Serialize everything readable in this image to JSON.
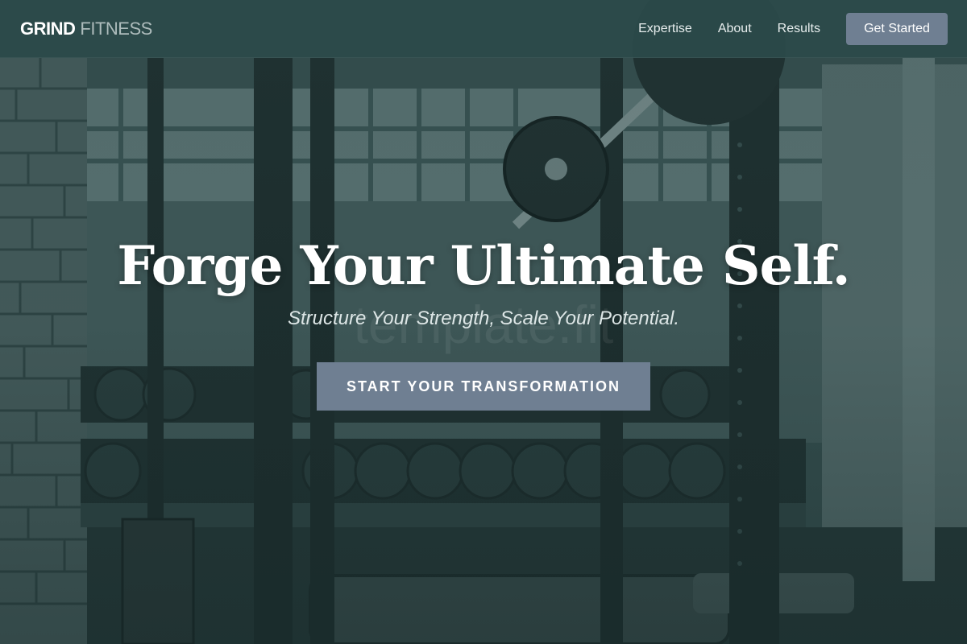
{
  "header": {
    "logo_strong": "GRIND",
    "logo_light": "FITNESS",
    "nav": [
      {
        "label": "Expertise"
      },
      {
        "label": "About"
      },
      {
        "label": "Results"
      }
    ],
    "cta_label": "Get Started"
  },
  "hero": {
    "title": "Forge Your Ultimate Self.",
    "subtitle": "Structure Your Strength, Scale Your Potential.",
    "watermark": "template.fit",
    "cta_label": "START YOUR TRANSFORMATION"
  },
  "colors": {
    "header_bg": "#2b4a4a",
    "accent_button": "#6f7f92",
    "scene_tint": "#2e4646"
  }
}
